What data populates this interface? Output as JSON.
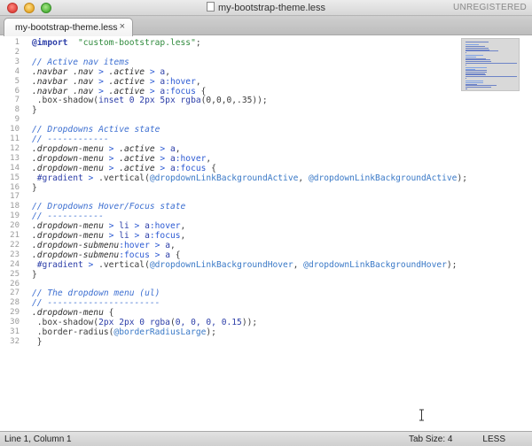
{
  "window": {
    "title": "my-bootstrap-theme.less",
    "registration": "UNREGISTERED"
  },
  "tabs": [
    {
      "label": "my-bootstrap-theme.less",
      "close": "×"
    }
  ],
  "editor": {
    "line_numbers": [
      "1",
      "2",
      "3",
      "4",
      "5",
      "6",
      "7",
      "8",
      "9",
      "10",
      "11",
      "12",
      "13",
      "14",
      "15",
      "16",
      "17",
      "18",
      "19",
      "20",
      "21",
      "22",
      "23",
      "24",
      "25",
      "26",
      "27",
      "28",
      "29",
      "30",
      "31",
      "32"
    ],
    "lines": [
      [
        [
          "t-at",
          "@import"
        ],
        [
          "",
          "  "
        ],
        [
          "t-str",
          "\"custom-bootstrap.less\""
        ],
        [
          "",
          ";"
        ]
      ],
      [],
      [
        [
          "t-comment",
          "// Active nav items"
        ]
      ],
      [
        [
          "t-sel",
          ".navbar .nav "
        ],
        [
          "t-op",
          ">"
        ],
        [
          "t-sel",
          " .active "
        ],
        [
          "t-op",
          ">"
        ],
        [
          "t-kw",
          " a"
        ],
        [
          "",
          ","
        ]
      ],
      [
        [
          "t-sel",
          ".navbar .nav "
        ],
        [
          "t-op",
          ">"
        ],
        [
          "t-sel",
          " .active "
        ],
        [
          "t-op",
          ">"
        ],
        [
          "t-kw",
          " a"
        ],
        [
          "t-pseudo",
          ":hover"
        ],
        [
          "",
          ","
        ]
      ],
      [
        [
          "t-sel",
          ".navbar .nav "
        ],
        [
          "t-op",
          ">"
        ],
        [
          "t-sel",
          " .active "
        ],
        [
          "t-op",
          ">"
        ],
        [
          "t-kw",
          " a"
        ],
        [
          "t-pseudo",
          ":focus"
        ],
        [
          "",
          " {"
        ]
      ],
      [
        [
          "",
          " .box-shadow("
        ],
        [
          "t-kw",
          "inset 0 2px 5px "
        ],
        [
          "t-kw",
          "rgba"
        ],
        [
          "",
          "(0,0,0,.35));"
        ]
      ],
      [
        [
          "",
          "}"
        ]
      ],
      [],
      [
        [
          "t-comment",
          "// Dropdowns Active state"
        ]
      ],
      [
        [
          "t-comment",
          "// ------------"
        ]
      ],
      [
        [
          "t-sel",
          ".dropdown-menu "
        ],
        [
          "t-op",
          ">"
        ],
        [
          "t-sel",
          " .active "
        ],
        [
          "t-op",
          ">"
        ],
        [
          "t-kw",
          " a"
        ],
        [
          "",
          ","
        ]
      ],
      [
        [
          "t-sel",
          ".dropdown-menu "
        ],
        [
          "t-op",
          ">"
        ],
        [
          "t-sel",
          " .active "
        ],
        [
          "t-op",
          ">"
        ],
        [
          "t-kw",
          " a"
        ],
        [
          "t-pseudo",
          ":hover"
        ],
        [
          "",
          ","
        ]
      ],
      [
        [
          "t-sel",
          ".dropdown-menu "
        ],
        [
          "t-op",
          ">"
        ],
        [
          "t-sel",
          " .active "
        ],
        [
          "t-op",
          ">"
        ],
        [
          "t-kw",
          " a"
        ],
        [
          "t-pseudo",
          ":focus"
        ],
        [
          "",
          " {"
        ]
      ],
      [
        [
          "",
          " "
        ],
        [
          "t-kw",
          "#gradient"
        ],
        [
          "t-op",
          " >"
        ],
        [
          "",
          " .vertical("
        ],
        [
          "t-var",
          "@dropdownLinkBackgroundActive"
        ],
        [
          "",
          ", "
        ],
        [
          "t-var",
          "@dropdownLinkBackgroundActive"
        ],
        [
          "",
          ");"
        ]
      ],
      [
        [
          "",
          "}"
        ]
      ],
      [],
      [
        [
          "t-comment",
          "// Dropdowns Hover/Focus state"
        ]
      ],
      [
        [
          "t-comment",
          "// -----------"
        ]
      ],
      [
        [
          "t-sel",
          ".dropdown-menu "
        ],
        [
          "t-op",
          ">"
        ],
        [
          "t-kw",
          " li "
        ],
        [
          "t-op",
          ">"
        ],
        [
          "t-kw",
          " a"
        ],
        [
          "t-pseudo",
          ":hover"
        ],
        [
          "",
          ","
        ]
      ],
      [
        [
          "t-sel",
          ".dropdown-menu "
        ],
        [
          "t-op",
          ">"
        ],
        [
          "t-kw",
          " li "
        ],
        [
          "t-op",
          ">"
        ],
        [
          "t-kw",
          " a"
        ],
        [
          "t-pseudo",
          ":focus"
        ],
        [
          "",
          ","
        ]
      ],
      [
        [
          "t-sel",
          ".dropdown-submenu"
        ],
        [
          "t-pseudo",
          ":hover"
        ],
        [
          "t-op",
          " >"
        ],
        [
          "t-kw",
          " a"
        ],
        [
          "",
          ","
        ]
      ],
      [
        [
          "t-sel",
          ".dropdown-submenu"
        ],
        [
          "t-pseudo",
          ":focus"
        ],
        [
          "t-op",
          " >"
        ],
        [
          "t-kw",
          " a"
        ],
        [
          "",
          " {"
        ]
      ],
      [
        [
          "",
          " "
        ],
        [
          "t-kw",
          "#gradient"
        ],
        [
          "t-op",
          " >"
        ],
        [
          "",
          " .vertical("
        ],
        [
          "t-var",
          "@dropdownLinkBackgroundHover"
        ],
        [
          "",
          ", "
        ],
        [
          "t-var",
          "@dropdownLinkBackgroundHover"
        ],
        [
          "",
          ");"
        ]
      ],
      [
        [
          "",
          "}"
        ]
      ],
      [],
      [
        [
          "t-comment",
          "// The dropdown menu (ul)"
        ]
      ],
      [
        [
          "t-comment",
          "// ----------------------"
        ]
      ],
      [
        [
          "t-sel",
          ".dropdown-menu"
        ],
        [
          "",
          " {"
        ]
      ],
      [
        [
          "",
          " .box-shadow("
        ],
        [
          "t-num",
          "2px 2px 0 "
        ],
        [
          "t-kw",
          "rgba"
        ],
        [
          "",
          "("
        ],
        [
          "t-num",
          "0, 0, 0, 0.15"
        ],
        [
          "",
          "));"
        ]
      ],
      [
        [
          "",
          " .border-radius("
        ],
        [
          "t-var",
          "@borderRadiusLarge"
        ],
        [
          "",
          ");"
        ]
      ],
      [
        [
          "",
          " }"
        ]
      ]
    ]
  },
  "status": {
    "position": "Line 1, Column 1",
    "tab_size": "Tab Size: 4",
    "syntax": "LESS"
  },
  "icons": {
    "file_icon": "document-icon",
    "cursor": "text-cursor-icon"
  }
}
